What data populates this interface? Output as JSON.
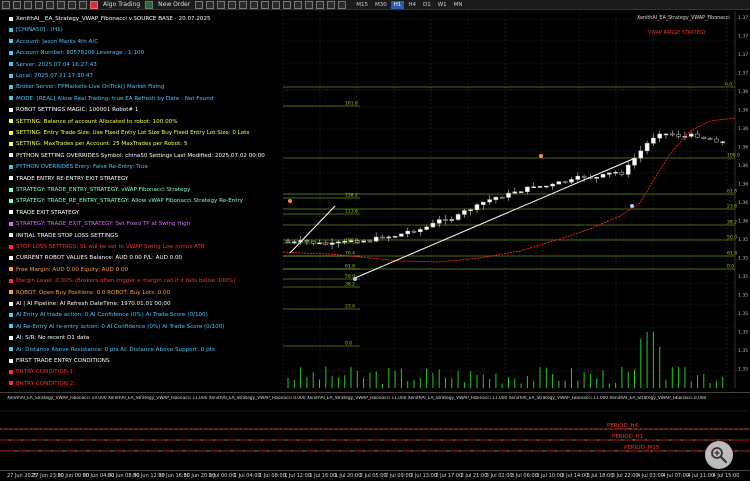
{
  "toolbar": {
    "algo_trading_label": "Algo Trading",
    "new_order_label": "New Order",
    "timeframes": [
      "M15",
      "M30",
      "H1",
      "H4",
      "D1",
      "W1",
      "MN"
    ],
    "active_timeframe": "H1"
  },
  "chart": {
    "title": "XenithAI_EA_Strategy_VWAP_Fibonacci",
    "object_label": "VWAP RANGE STRATEGY",
    "fib_levels": [
      "161.8",
      "138.2",
      "123.6",
      "100.0",
      "76.4",
      "61.8",
      "50.0",
      "38.2",
      "23.6",
      "0.0",
      "0.0",
      "23.6",
      "38.2",
      "50.0",
      "61.8"
    ],
    "price_axis": [
      "1.37",
      "1.37",
      "1.37",
      "1.37",
      "1.36",
      "1.36",
      "1.36",
      "1.36",
      "1.36",
      "1.36",
      "1.36",
      "1.36",
      "1.35",
      "1.35",
      "1.35",
      "1.35",
      "1.35",
      "1.35",
      "1.35",
      "1.35"
    ]
  },
  "info_panel": {
    "lines": [
      {
        "text": "XenithAI__EA_Strategy_VWAP_Fibonacci v.SOURCE BASE - 20.07.2025",
        "color": "#ffffff",
        "bullet": "#ffffff"
      },
      {
        "text": "[CHINA50] : (H1)",
        "color": "#4fc3f7",
        "bullet": "#4fc3f7"
      },
      {
        "text": "Account: Jason Marks 4th A/C",
        "color": "#4fc3f7",
        "bullet": "#4fc3f7"
      },
      {
        "text": "Account Number: 80578206  Leverage : 1:100",
        "color": "#4fc3f7",
        "bullet": "#4fc3f7"
      },
      {
        "text": "Server: 2025.07.04 16:27:43",
        "color": "#4fc3f7",
        "bullet": "#4fc3f7"
      },
      {
        "text": "Local: 2025.07.21 17:30:47",
        "color": "#4fc3f7",
        "bullet": "#4fc3f7"
      },
      {
        "text": "Broker Server: FPMarkets-Live  OnTick()  Market Fixing",
        "color": "#4fc3f7",
        "bullet": "#4fc3f7"
      },
      {
        "text": "MODE: [REAL]  Allow Real Trading: true  EA Refresh by Date : Not Found",
        "color": "#4fc3f7",
        "bullet": "#4fc3f7"
      },
      {
        "text": "ROBOT SETTINGS  MAGIC: 100001  Robot# 1",
        "color": "#ffffff",
        "bullet": "#ffffff"
      },
      {
        "text": "SETTING: Balance of account Allocated to robot: 100.00%",
        "color": "#ffff40",
        "bullet": "#ffff40"
      },
      {
        "text": "SETTING: Entry Trade Size: Use Fixed Entry Lot Size  Buy Fixed Entry Lot Size: 0 Lots",
        "color": "#ffff40",
        "bullet": "#ffff40"
      },
      {
        "text": "SETTING: MaxTrades per Account: 25  MaxTrades per Robot: 5",
        "color": "#ffff40",
        "bullet": "#ffff40"
      },
      {
        "text": "PYTHON SETTING OVERRIDES  Symbol: china50  Settings Last Modified: 2025.07.02 00:00",
        "color": "#ffffff",
        "bullet": "#ffffff"
      },
      {
        "text": "PYTHON OVERRIDES  Entry: False  Re-Entry: True",
        "color": "#4fc3f7",
        "bullet": "#4fc3f7"
      },
      {
        "text": "TRADE ENTRY  RE-ENTRY  EXIT STRATEGY",
        "color": "#ffffff",
        "bullet": "#ffffff"
      },
      {
        "text": "STRATEGY: TRADE_ENTRY_STRATEGY:  vWAP Fibonacci Strategy",
        "color": "#7fffd4",
        "bullet": "#7fffd4"
      },
      {
        "text": "STRATEGY: TRADE_RE_ENTRY_STRATEGY:  Allow vWAP Fibonacci Strategy Re-Entry",
        "color": "#7fffd4",
        "bullet": "#7fffd4"
      },
      {
        "text": "TRADE EXIT STRATEGY",
        "color": "#ffffff",
        "bullet": "#ffffff"
      },
      {
        "text": "STRATEGY: TRADE_EXIT_STRATEGY:  Set Fixed TP at Swing High",
        "color": "#e066ff",
        "bullet": "#e066ff"
      },
      {
        "text": "INITIAL TRADE STOP LOSS SETTINGS",
        "color": "#ffffff",
        "bullet": "#ffffff"
      },
      {
        "text": "STOP LOSS SETTINGS:  SL will be set to VWAP Swing Low minus ATR",
        "color": "#ff3030",
        "bullet": "#ff3030"
      },
      {
        "text": "CURRENT ROBOT VALUES  Balance: AUD 0.00  P/L: AUD 0.00",
        "color": "#ffffff",
        "bullet": "#ffffff"
      },
      {
        "text": "Free Margin: AUD 0.00  Equity: AUD 0.00",
        "color": "#ffa040",
        "bullet": "#ffa040"
      },
      {
        "text": "Margin Level: 0.00% (Brokers often trigger a margin call if it falls below 100%)",
        "color": "#ff3030",
        "bullet": "#ff3030"
      },
      {
        "text": "ROBOT: Open Buy Positions: 0.0  ROBOT: Buy Lots: 0.00",
        "color": "#ffa040",
        "bullet": "#ffa040"
      },
      {
        "text": "AI | AI Pipeline:  AI Refresh DateTime: 1970.01.01 00:00",
        "color": "#ffffff",
        "bullet": "#ffffff"
      },
      {
        "text": "AI Entry  AI trade action: 0  AI Confidence (0%)  AI Trade Score (0/100)",
        "color": "#4fc3f7",
        "bullet": "#4fc3f7"
      },
      {
        "text": "AI Re-Entry  AI re-entry action: 0  AI Confidence (0%)  AI Trade Score (0/100)",
        "color": "#4fc3f7",
        "bullet": "#4fc3f7"
      },
      {
        "text": "AI: S/R: No recent D1 data",
        "color": "#ffffff",
        "bullet": "#ffffff"
      },
      {
        "text": "AI: Distance Above Resistance: 0 pts  AI: Distance Above Support: 0 pts",
        "color": "#4fc3f7",
        "bullet": "#4fc3f7"
      },
      {
        "text": "FIRST TRADE ENTRY CONDITIONS",
        "color": "#ffffff",
        "bullet": "#ffffff"
      },
      {
        "text": "ENTRY CONDITION 1:",
        "color": "#ff3030",
        "bullet": "#ff3030"
      },
      {
        "text": "ENTRY CONDITION 2:",
        "color": "#ff3030",
        "bullet": "#ff3030"
      },
      {
        "text": "ENTRY CONDITION 3:",
        "color": "#ff3030",
        "bullet": "#ff3030"
      }
    ]
  },
  "subwindow": {
    "title": "XenithAI_EA_Strategy_VWAP_Fibonacci 14.000  XenithAI_EA_Strategy_VWAP_Fibonacci 11.000  XenithAI_EA_Strategy_VWAP_Fibonacci 0.000  XenithAI_EA_Strategy_VWAP_Fibonacci 11.000  XenithAI_EA_Strategy_VWAP_Fibonacci 11.000  XenithAI_EA_Strategy_VWAP_Fibonacci 11.000  XenithAI_EA_Strategy_VWAP_Fibonacci 0.000  XenithAI_EA_Strategy_VWAP_Fibonacci 11.000  XenithAI_EA_Strategy_VWAP_Fibonacci 11.000  XenithAI_EA_Strategy_VWAP_Fibonacci 11.000",
    "periods": [
      "PERIOD_H4",
      "PERIOD_H1",
      "PERIOD_M15"
    ]
  },
  "time_axis": [
    "27 Jun 2025",
    "27 Jun 23:00",
    "30 Jun 00:00",
    "30 Jun 04:00",
    "30 Jun 08:00",
    "30 Jun 12:00",
    "30 Jun 16:00",
    "30 Jun 20:00",
    "1 Jul 00:00",
    "1 Jul 04:00",
    "1 Jul 08:00",
    "1 Jul 12:00",
    "1 Jul 16:00",
    "1 Jul 20:00",
    "2 Jul 05:00",
    "2 Jul 09:00",
    "2 Jul 13:00",
    "2 Jul 17:00",
    "2 Jul 21:00",
    "3 Jul 02:00",
    "3 Jul 06:00",
    "3 Jul 10:00",
    "3 Jul 14:00",
    "3 Jul 18:00",
    "3 Jul 22:00",
    "4 Jul 03:00",
    "4 Jul 07:00",
    "4 Jul 11:00",
    "4 Jul 15:00"
  ],
  "colors": {
    "accent": "#2d5aa8",
    "fib_line": "#9acd32",
    "vwap": "#ff2020",
    "bull_candle": "#ffffff",
    "bear_candle": "#000000",
    "volume": "#22cc22"
  }
}
